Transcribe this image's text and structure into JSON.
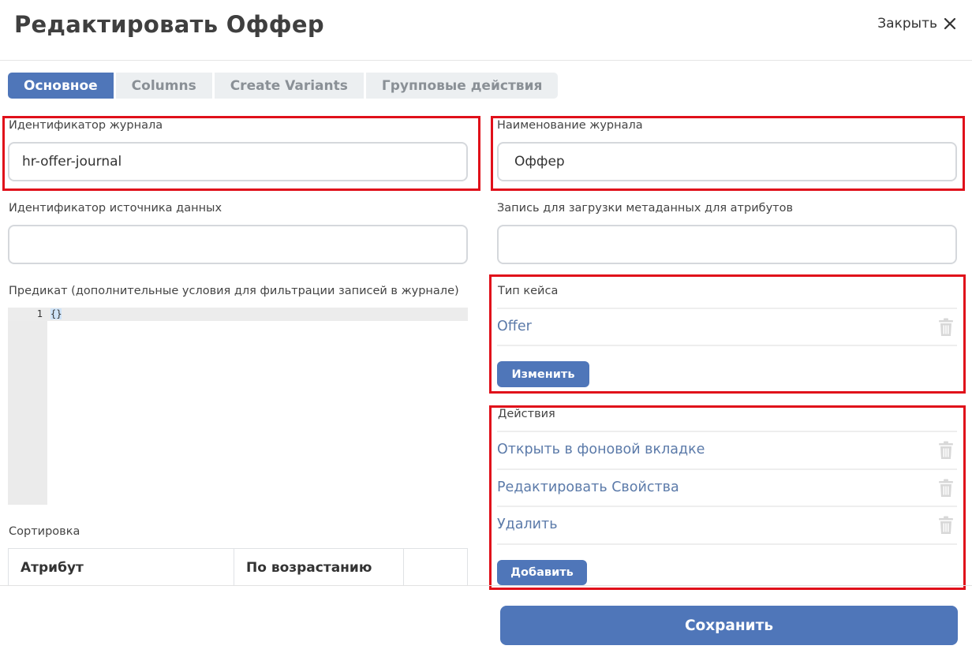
{
  "header": {
    "title": "Редактировать Оффер",
    "close_label": "Закрыть"
  },
  "tabs": [
    {
      "label": "Основное",
      "active": true
    },
    {
      "label": "Columns",
      "active": false
    },
    {
      "label": "Create Variants",
      "active": false
    },
    {
      "label": "Групповые действия",
      "active": false
    }
  ],
  "form": {
    "journal_id": {
      "label": "Идентификатор журнала",
      "value": "hr-offer-journal"
    },
    "journal_name": {
      "label": "Наименование журнала",
      "value": "Оффер"
    },
    "source_id": {
      "label": "Идентификатор источника данных",
      "value": ""
    },
    "metadata_record": {
      "label": "Запись для загрузки метаданных для атрибутов",
      "value": ""
    },
    "predicate": {
      "label": "Предикат (дополнительные условия для фильтрации записей в журнале)",
      "line_number": "1",
      "code": "{}"
    },
    "case_type": {
      "label": "Тип кейса",
      "items": [
        "Offer"
      ],
      "change_button": "Изменить"
    },
    "actions": {
      "label": "Действия",
      "items": [
        "Открыть в фоновой вкладке",
        "Редактировать Свойства",
        "Удалить"
      ],
      "add_button": "Добавить"
    },
    "sorting": {
      "label": "Сортировка",
      "columns": [
        "Атрибут",
        "По возрастанию",
        ""
      ]
    }
  },
  "footer": {
    "save_label": "Сохранить"
  },
  "colors": {
    "accent": "#4f76b9",
    "highlight": "#e0101a",
    "link": "#5b7aa9"
  }
}
